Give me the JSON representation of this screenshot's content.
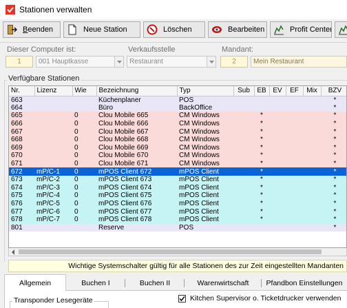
{
  "window": {
    "title": "Stationen verwalten"
  },
  "toolbar": {
    "beenden_accel": "B",
    "beenden_rest": "eenden",
    "neue_station": "Neue Station",
    "loeschen": "Löschen",
    "bearbeiten": "Bearbeiten",
    "profit_center": "Profit Center"
  },
  "header": {
    "computer_label": "Dieser Computer ist:",
    "computer_num": "1",
    "computer_name": "001  Hauptkasse",
    "verkaufsstelle_label": "Verkaufsstelle",
    "verkaufsstelle_value": "Restaurant",
    "mandant_label": "Mandant:",
    "mandant_num": "2",
    "mandant_name": "Mein Restaurant"
  },
  "stations": {
    "group_title": "Verfügbare Stationen",
    "columns": [
      "Nr.",
      "Lizenz",
      "Wie",
      "Bezeichnung",
      "Typ",
      "Sub",
      "EB",
      "EV",
      "EF",
      "Mix",
      "BZV"
    ],
    "rows": [
      {
        "nr": "663",
        "lizenz": "",
        "wie": "",
        "bez": "Küchenplaner",
        "typ": "POS",
        "sub": "",
        "eb": "",
        "ev": "",
        "ef": "",
        "mix": "",
        "bzv": "*",
        "cls": "purple"
      },
      {
        "nr": "664",
        "lizenz": "",
        "wie": "",
        "bez": "Büro",
        "typ": "BackOffice",
        "sub": "",
        "eb": "",
        "ev": "",
        "ef": "",
        "mix": "",
        "bzv": "*",
        "cls": "purple"
      },
      {
        "nr": "665",
        "lizenz": "",
        "wie": "0",
        "bez": "Clou Mobile 665",
        "typ": "CM Windows",
        "sub": "",
        "eb": "*",
        "ev": "",
        "ef": "",
        "mix": "",
        "bzv": "*",
        "cls": "pink"
      },
      {
        "nr": "666",
        "lizenz": "",
        "wie": "0",
        "bez": "Clou Mobile 666",
        "typ": "CM Windows",
        "sub": "",
        "eb": "*",
        "ev": "",
        "ef": "",
        "mix": "",
        "bzv": "*",
        "cls": "pink"
      },
      {
        "nr": "667",
        "lizenz": "",
        "wie": "0",
        "bez": "Clou Mobile 667",
        "typ": "CM Windows",
        "sub": "",
        "eb": "*",
        "ev": "",
        "ef": "",
        "mix": "",
        "bzv": "*",
        "cls": "pink"
      },
      {
        "nr": "668",
        "lizenz": "",
        "wie": "0",
        "bez": "Clou Mobile 668",
        "typ": "CM Windows",
        "sub": "",
        "eb": "*",
        "ev": "",
        "ef": "",
        "mix": "",
        "bzv": "*",
        "cls": "pink"
      },
      {
        "nr": "669",
        "lizenz": "",
        "wie": "0",
        "bez": "Clou Mobile 669",
        "typ": "CM Windows",
        "sub": "",
        "eb": "*",
        "ev": "",
        "ef": "",
        "mix": "",
        "bzv": "*",
        "cls": "pink"
      },
      {
        "nr": "670",
        "lizenz": "",
        "wie": "0",
        "bez": "Clou Mobile 670",
        "typ": "CM Windows",
        "sub": "",
        "eb": "*",
        "ev": "",
        "ef": "",
        "mix": "",
        "bzv": "*",
        "cls": "pink"
      },
      {
        "nr": "671",
        "lizenz": "",
        "wie": "0",
        "bez": "Clou Mobile 671",
        "typ": "CM Windows",
        "sub": "",
        "eb": "*",
        "ev": "",
        "ef": "",
        "mix": "",
        "bzv": "*",
        "cls": "pink"
      },
      {
        "nr": "672",
        "lizenz": "mP/C-1",
        "wie": "0",
        "bez": "mPOS Client 672",
        "typ": "mPOS Client",
        "sub": "",
        "eb": "*",
        "ev": "",
        "ef": "",
        "mix": "",
        "bzv": "*",
        "cls": "sel"
      },
      {
        "nr": "673",
        "lizenz": "mP/C-2",
        "wie": "0",
        "bez": "mPOS Client 673",
        "typ": "mPOS Client",
        "sub": "",
        "eb": "*",
        "ev": "",
        "ef": "",
        "mix": "",
        "bzv": "*",
        "cls": "cyan"
      },
      {
        "nr": "674",
        "lizenz": "mP/C-3",
        "wie": "0",
        "bez": "mPOS Client 674",
        "typ": "mPOS Client",
        "sub": "",
        "eb": "*",
        "ev": "",
        "ef": "",
        "mix": "",
        "bzv": "*",
        "cls": "cyan"
      },
      {
        "nr": "675",
        "lizenz": "mP/C-4",
        "wie": "0",
        "bez": "mPOS Client 675",
        "typ": "mPOS Client",
        "sub": "",
        "eb": "*",
        "ev": "",
        "ef": "",
        "mix": "",
        "bzv": "*",
        "cls": "cyan"
      },
      {
        "nr": "676",
        "lizenz": "mP/C-5",
        "wie": "0",
        "bez": "mPOS Client 676",
        "typ": "mPOS Client",
        "sub": "",
        "eb": "*",
        "ev": "",
        "ef": "",
        "mix": "",
        "bzv": "*",
        "cls": "cyan"
      },
      {
        "nr": "677",
        "lizenz": "mP/C-6",
        "wie": "0",
        "bez": "mPOS Client 677",
        "typ": "mPOS Client",
        "sub": "",
        "eb": "*",
        "ev": "",
        "ef": "",
        "mix": "",
        "bzv": "*",
        "cls": "cyan"
      },
      {
        "nr": "678",
        "lizenz": "mP/C-7",
        "wie": "0",
        "bez": "mPOS Client 678",
        "typ": "mPOS Client",
        "sub": "",
        "eb": "*",
        "ev": "",
        "ef": "",
        "mix": "",
        "bzv": "*",
        "cls": "cyan"
      },
      {
        "nr": "801",
        "lizenz": "",
        "wie": "",
        "bez": "Reserve",
        "typ": "POS",
        "sub": "",
        "eb": "",
        "ev": "",
        "ef": "",
        "mix": "",
        "bzv": "*",
        "cls": "purple"
      }
    ]
  },
  "info_text": "Wichtige Systemschalter gültig für alle Stationen des zur Zeit eingestellten Mandanten",
  "tabs": [
    "Allgemein",
    "Buchen I",
    "Buchen II",
    "Warenwirtschaft",
    "Pfandbon Einstellungen"
  ],
  "bottom": {
    "transponder_label": "Transponder Lesegeräte",
    "kitchen_checkbox_label": "Kitchen Supervisor o. Ticketdrucker verwenden",
    "kitchen_checked": true
  }
}
